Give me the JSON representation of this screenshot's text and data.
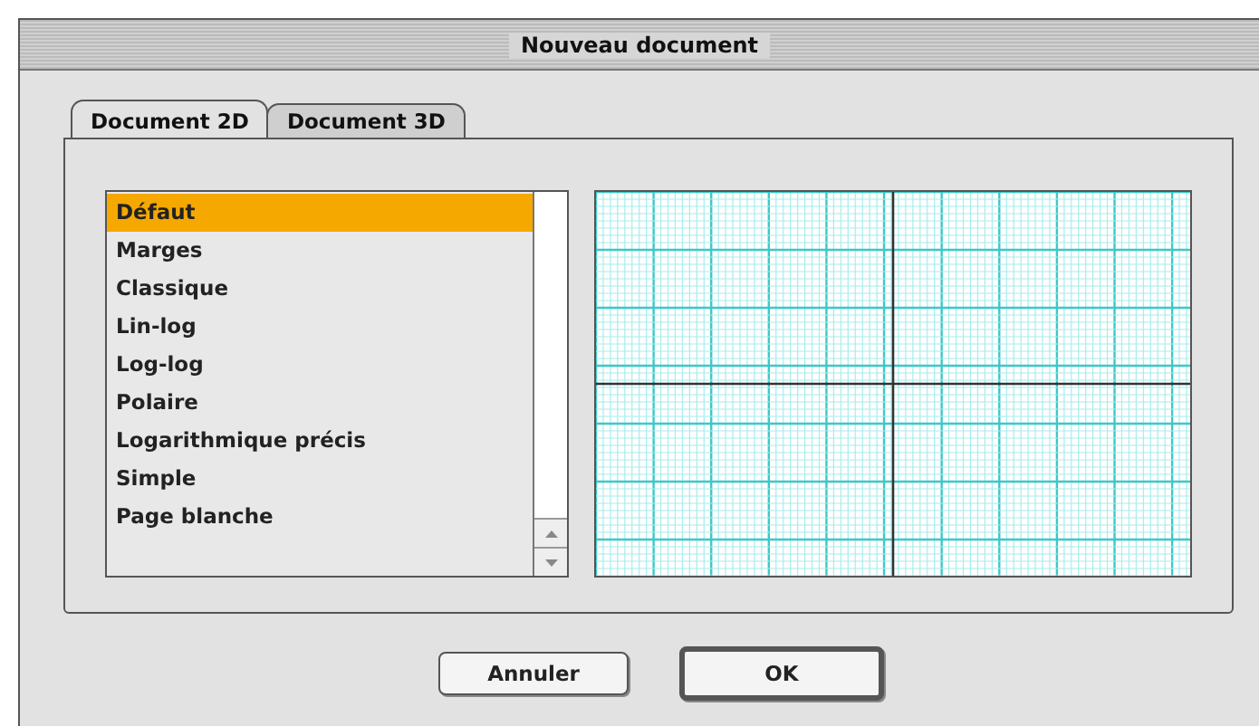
{
  "window": {
    "title": "Nouveau document"
  },
  "tabs": [
    {
      "label": "Document 2D",
      "selected": true
    },
    {
      "label": "Document 3D",
      "selected": false
    }
  ],
  "templates": [
    {
      "label": "Défaut",
      "selected": true
    },
    {
      "label": "Marges",
      "selected": false
    },
    {
      "label": "Classique",
      "selected": false
    },
    {
      "label": "Lin-log",
      "selected": false
    },
    {
      "label": "Log-log",
      "selected": false
    },
    {
      "label": "Polaire",
      "selected": false
    },
    {
      "label": "Logarithmique précis",
      "selected": false
    },
    {
      "label": "Simple",
      "selected": false
    },
    {
      "label": "Page blanche",
      "selected": false
    }
  ],
  "buttons": [
    {
      "label": "Annuler",
      "default": false
    },
    {
      "label": "OK",
      "default": true
    }
  ]
}
